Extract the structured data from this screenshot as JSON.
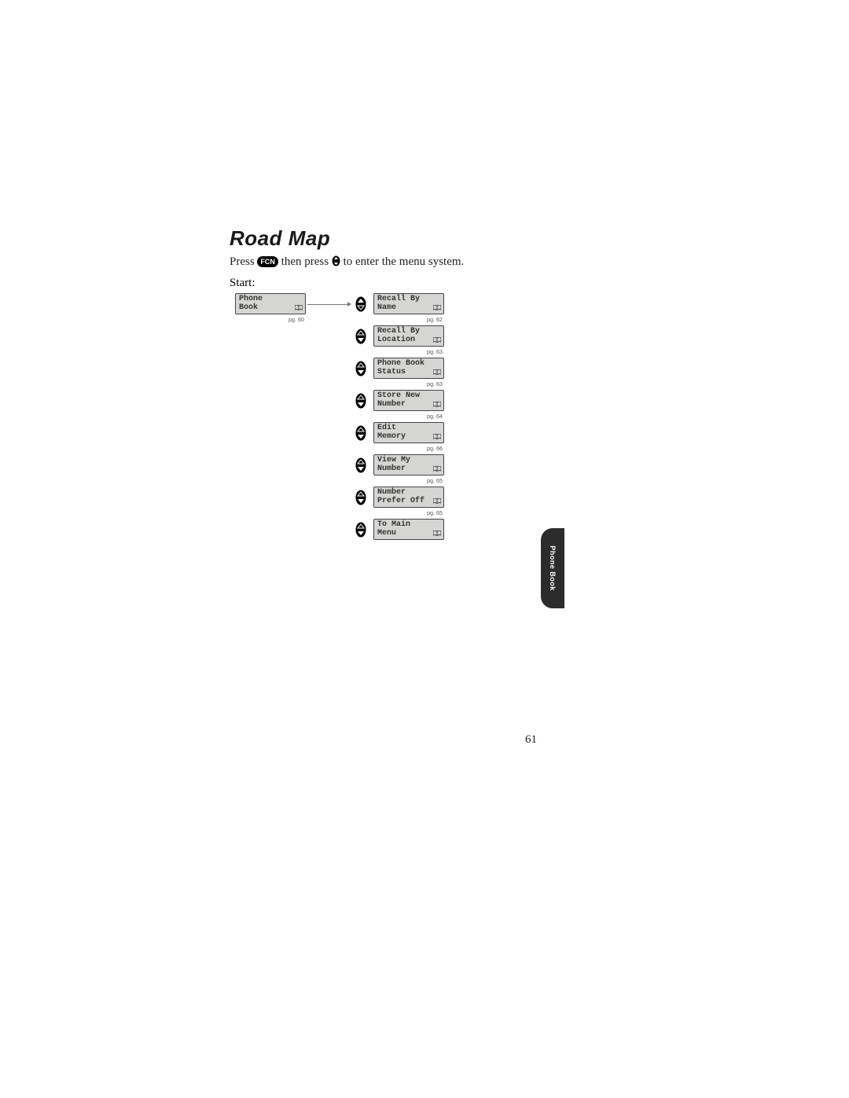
{
  "title": "Road Map",
  "instr": {
    "p1": "Press",
    "p2": "then press",
    "p3": "to enter the menu system."
  },
  "fcn_label": "FCN",
  "start_label": "Start:",
  "root_screen": {
    "line1": "Phone",
    "line2": "Book",
    "pg": "pg. 60"
  },
  "menu_items": [
    {
      "line1": "Recall By",
      "line2": "Name",
      "pg": "pg. 62"
    },
    {
      "line1": "Recall By",
      "line2": "Location",
      "pg": "pg. 63"
    },
    {
      "line1": "Phone Book",
      "line2": "Status",
      "pg": "pg. 63"
    },
    {
      "line1": "Store New",
      "line2": "Number",
      "pg": "pg. 64"
    },
    {
      "line1": "Edit",
      "line2": "Memory",
      "pg": "pg. 66"
    },
    {
      "line1": "View My",
      "line2": "Number",
      "pg": "pg. 65"
    },
    {
      "line1": "Number",
      "line2": "Prefer Off",
      "pg": "pg. 65"
    },
    {
      "line1": "To Main",
      "line2": "Menu",
      "pg": ""
    }
  ],
  "side_tab": "Phone Book",
  "page_number": "61"
}
